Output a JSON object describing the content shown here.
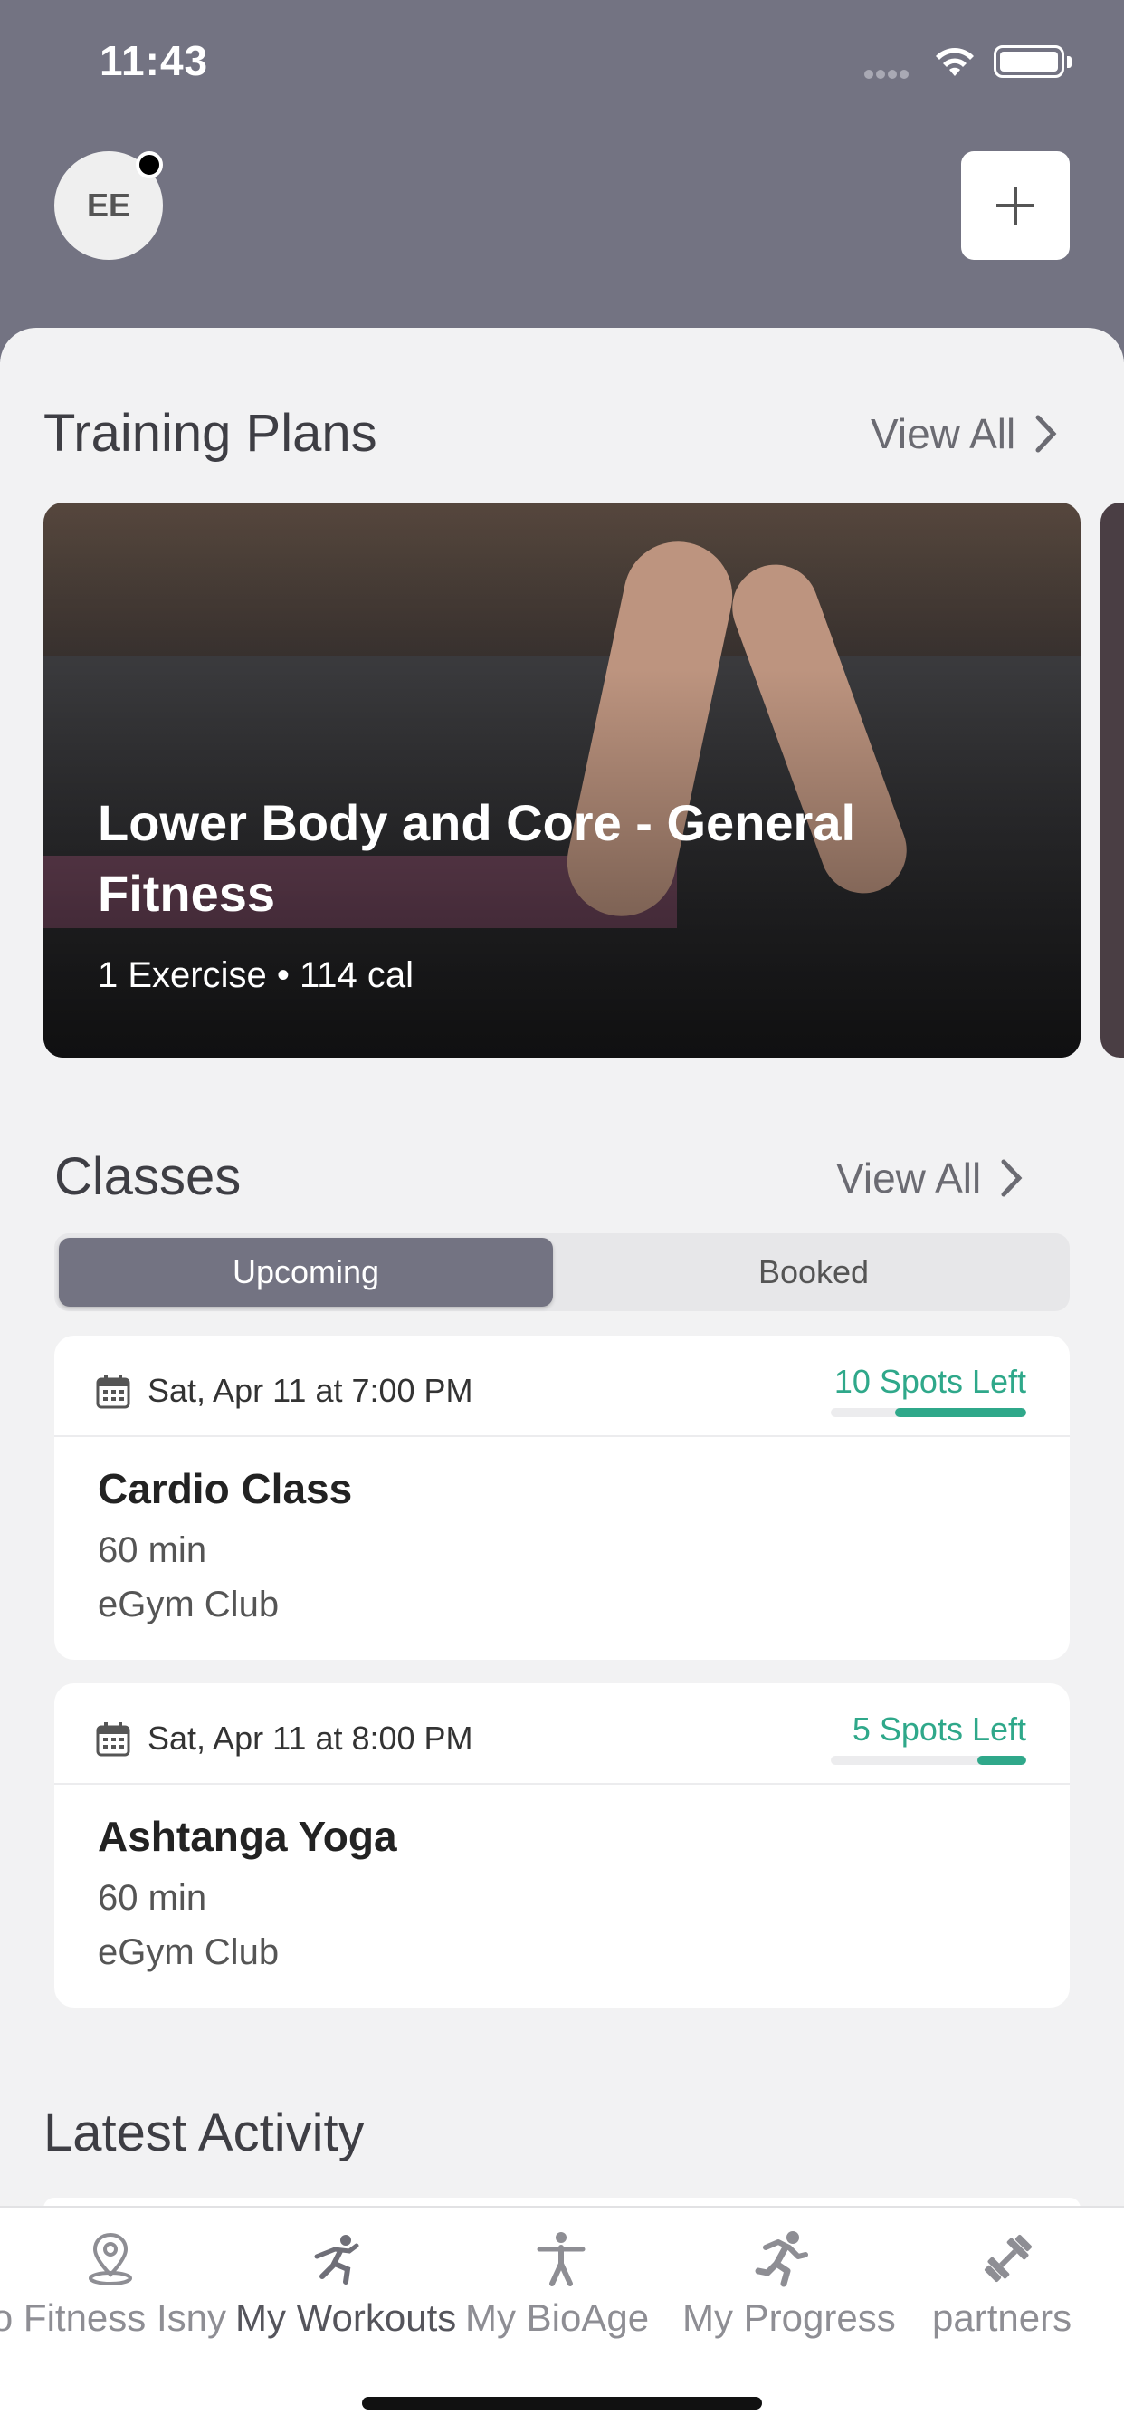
{
  "status_bar": {
    "time": "11:43"
  },
  "header": {
    "avatar_initials": "EE",
    "add_label": "+"
  },
  "training_plans": {
    "title": "Training Plans",
    "view_all": "View All",
    "card": {
      "title": "Lower Body and Core - General Fitness",
      "meta": "1 Exercise • 114 cal"
    }
  },
  "classes": {
    "title": "Classes",
    "view_all": "View All",
    "tabs": {
      "upcoming": "Upcoming",
      "booked": "Booked"
    },
    "items": [
      {
        "date": "Sat, Apr 11 at 7:00 PM",
        "spots": "10 Spots Left",
        "spots_fraction": 0.67,
        "name": "Cardio Class",
        "duration": "60 min",
        "club": "eGym Club"
      },
      {
        "date": "Sat, Apr 11 at 8:00 PM",
        "spots": "5 Spots Left",
        "spots_fraction": 0.25,
        "name": "Ashtanga Yoga",
        "duration": "60 min",
        "club": "eGym Club"
      }
    ]
  },
  "latest_activity": {
    "title": "Latest Activity"
  },
  "tabbar": {
    "items": [
      {
        "label": "Physio Fitness Isny",
        "icon": "location-pin-icon"
      },
      {
        "label": "My Workouts",
        "icon": "workout-figure-icon"
      },
      {
        "label": "My BioAge",
        "icon": "person-icon"
      },
      {
        "label": "My Progress",
        "icon": "running-figure-icon"
      },
      {
        "label": "partners",
        "icon": "dumbbell-icon"
      }
    ]
  },
  "colors": {
    "header": "#737382",
    "accent_green": "#2fa88a",
    "background": "#f2f2f3"
  }
}
